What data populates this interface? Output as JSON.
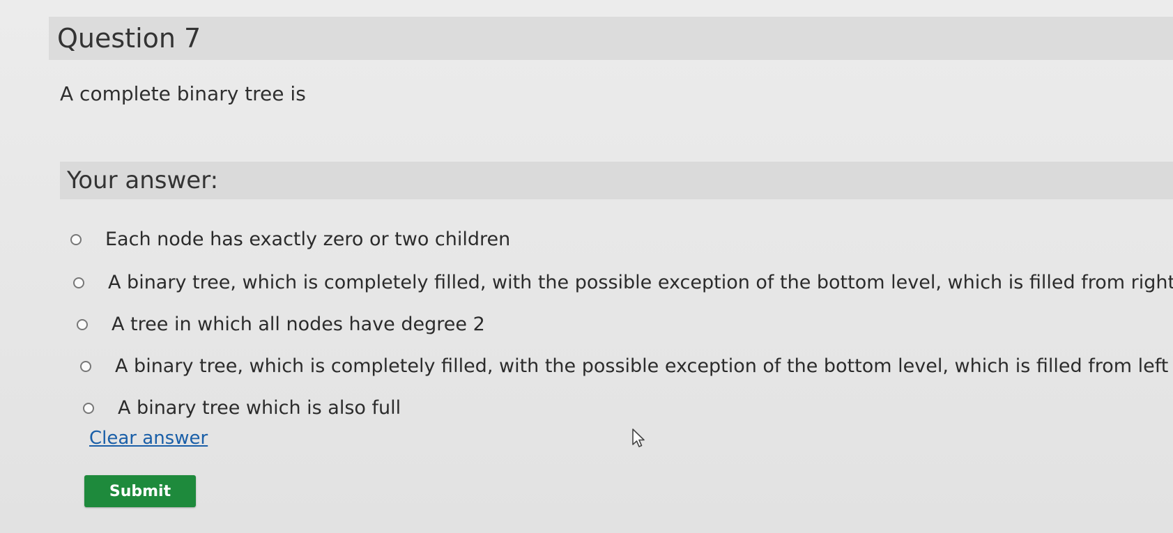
{
  "question": {
    "title": "Question 7",
    "text": "A complete binary tree is"
  },
  "answer": {
    "heading": "Your answer:",
    "options": [
      {
        "label": "Each node has exactly zero or two children"
      },
      {
        "label": "A binary tree, which is completely filled, with the possible exception of the bottom level, which is filled from right to left"
      },
      {
        "label": "A tree in which all nodes have degree 2"
      },
      {
        "label": "A binary tree, which is completely filled, with the possible exception of the bottom level, which is filled from left to right"
      },
      {
        "label": "A binary tree which is also full"
      }
    ],
    "clear_label": "Clear answer",
    "submit_label": "Submit"
  },
  "colors": {
    "submit_bg": "#1e8a3c",
    "link": "#1a5fa8"
  },
  "icons": {
    "radio": "radio-button-icon",
    "cursor": "mouse-pointer-icon"
  }
}
